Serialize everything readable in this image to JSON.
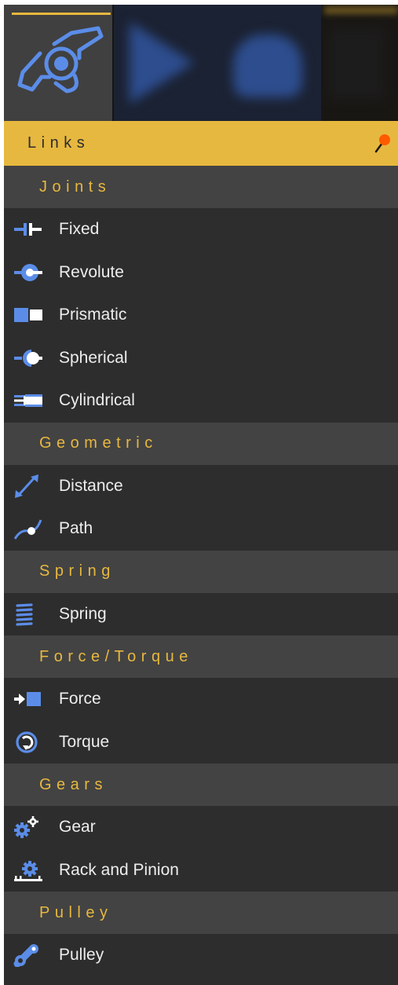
{
  "header": {
    "tabs": [
      {
        "icon": "linkage-icon",
        "active": true
      },
      {
        "icon": "play-icon",
        "active": false
      },
      {
        "icon": "robot-icon",
        "active": false
      },
      {
        "icon": "blank-icon",
        "active": false
      }
    ]
  },
  "panel": {
    "title": "Links",
    "title_icon": "pin-icon",
    "sections": [
      {
        "title": "Joints",
        "items": [
          {
            "label": "Fixed",
            "icon": "fixed-joint-icon"
          },
          {
            "label": "Revolute",
            "icon": "revolute-joint-icon"
          },
          {
            "label": "Prismatic",
            "icon": "prismatic-joint-icon"
          },
          {
            "label": "Spherical",
            "icon": "spherical-joint-icon"
          },
          {
            "label": "Cylindrical",
            "icon": "cylindrical-joint-icon"
          }
        ]
      },
      {
        "title": "Geometric",
        "items": [
          {
            "label": "Distance",
            "icon": "distance-icon"
          },
          {
            "label": "Path",
            "icon": "path-icon"
          }
        ]
      },
      {
        "title": "Spring",
        "items": [
          {
            "label": "Spring",
            "icon": "spring-icon"
          }
        ]
      },
      {
        "title": "Force/Torque",
        "items": [
          {
            "label": "Force",
            "icon": "force-icon"
          },
          {
            "label": "Torque",
            "icon": "torque-icon"
          }
        ]
      },
      {
        "title": "Gears",
        "items": [
          {
            "label": "Gear",
            "icon": "gear-icon"
          },
          {
            "label": "Rack and Pinion",
            "icon": "rack-and-pinion-icon"
          }
        ]
      },
      {
        "title": "Pulley",
        "items": [
          {
            "label": "Pulley",
            "icon": "pulley-icon"
          }
        ]
      }
    ]
  },
  "colors": {
    "accent": "#e7b83f",
    "icon": "#5b8de8",
    "panel_bg": "#2d2d2d",
    "section_bg": "#434343",
    "item_text": "#ededed",
    "pin": "#ff5a00"
  }
}
